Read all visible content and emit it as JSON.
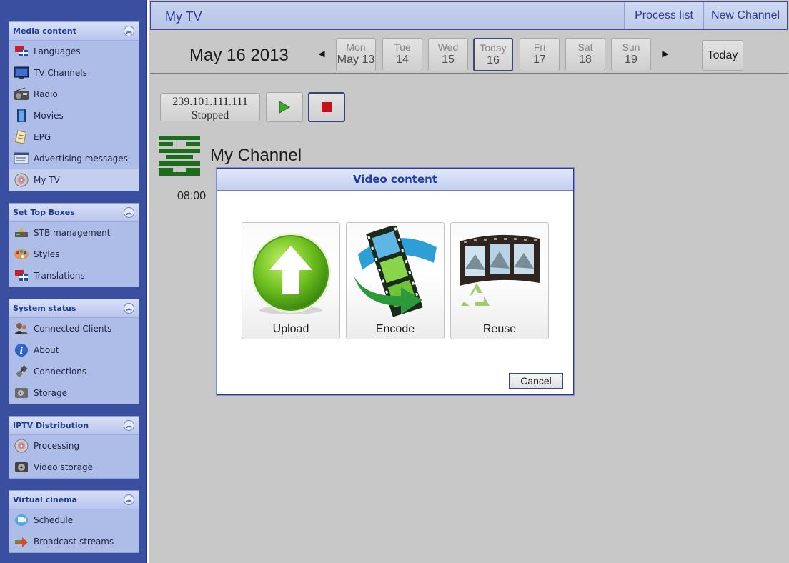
{
  "sidebar": {
    "sections": [
      {
        "title": "Media content",
        "items": [
          "Languages",
          "TV Channels",
          "Radio",
          "Movies",
          "EPG",
          "Advertising messages",
          "My TV"
        ]
      },
      {
        "title": "Set Top Boxes",
        "items": [
          "STB management",
          "Styles",
          "Translations"
        ]
      },
      {
        "title": "System status",
        "items": [
          "Connected Clients",
          "About",
          "Connections",
          "Storage"
        ]
      },
      {
        "title": "IPTV Distribution",
        "items": [
          "Processing",
          "Video storage"
        ]
      },
      {
        "title": "Virtual cinema",
        "items": [
          "Schedule",
          "Broadcast streams"
        ]
      }
    ],
    "active_item": "My TV"
  },
  "header": {
    "title": "My TV",
    "process_list_label": "Process list",
    "new_channel_label": "New Channel"
  },
  "datebar": {
    "current_date": "May 16 2013",
    "days": [
      {
        "name": "Mon",
        "num": "May 13"
      },
      {
        "name": "Tue",
        "num": "14"
      },
      {
        "name": "Wed",
        "num": "15"
      },
      {
        "name": "Today",
        "num": "16"
      },
      {
        "name": "Fri",
        "num": "17"
      },
      {
        "name": "Sat",
        "num": "18"
      },
      {
        "name": "Sun",
        "num": "19"
      }
    ],
    "today_label": "Today"
  },
  "stream": {
    "ip": "239.101.111.111",
    "status": "Stopped"
  },
  "channel": {
    "name": "My Channel",
    "time": "08:00"
  },
  "modal": {
    "title": "Video content",
    "options": [
      "Upload",
      "Encode",
      "Reuse"
    ],
    "cancel_label": "Cancel"
  },
  "colors": {
    "sidebar_bg": "#3a4fa0",
    "panel_bg": "#aebde8",
    "header_text": "#2b3f8f",
    "modal_title": "#1f3da0",
    "main_bg": "#c8c8c8"
  }
}
